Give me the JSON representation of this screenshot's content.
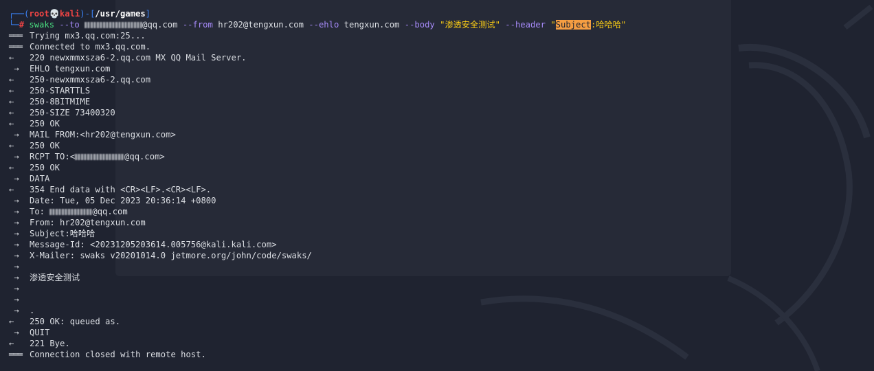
{
  "prompt": {
    "corner": "┌──",
    "open": "(",
    "user": "root",
    "skull_icon": "💀",
    "host": "kali",
    "close_mid": ")-[",
    "path": "/usr/games",
    "close": "]",
    "hash_prefix": "└─",
    "hash": "#"
  },
  "command": {
    "name": "swaks",
    "to_flag": "--to",
    "to_domain": "@qq.com",
    "from_flag": "--from",
    "from_value": "hr202@tengxun.com",
    "ehlo_flag": "--ehlo",
    "ehlo_value": "tengxun.com",
    "body_flag": "--body",
    "body_value": "\"渗透安全测试\"",
    "header_flag": "--header",
    "header_q": "\"",
    "header_key": "Subject",
    "header_rest": ":哈哈哈\""
  },
  "output": [
    {
      "arrow": "===",
      "text": "Trying mx3.qq.com:25..."
    },
    {
      "arrow": "===",
      "text": "Connected to mx3.qq.com."
    },
    {
      "arrow": "<-",
      "text": "220 newxmmxsza6-2.qq.com MX QQ Mail Server."
    },
    {
      "arrow": " ->",
      "text": "EHLO tengxun.com"
    },
    {
      "arrow": "<-",
      "text": "250-newxmmxsza6-2.qq.com"
    },
    {
      "arrow": "<-",
      "text": "250-STARTTLS"
    },
    {
      "arrow": "<-",
      "text": "250-8BITMIME"
    },
    {
      "arrow": "<-",
      "text": "250-SIZE 73400320"
    },
    {
      "arrow": "<-",
      "text": "250 OK"
    },
    {
      "arrow": " ->",
      "text": "MAIL FROM:<hr202@tengxun.com>"
    },
    {
      "arrow": "<-",
      "text": "250 OK"
    },
    {
      "arrow": " ->",
      "text": "RCPT TO:<",
      "blur": 72,
      "after": "@qq.com>"
    },
    {
      "arrow": "<-",
      "text": "250 OK"
    },
    {
      "arrow": " ->",
      "text": "DATA"
    },
    {
      "arrow": "<-",
      "text": "354 End data with <CR><LF>.<CR><LF>."
    },
    {
      "arrow": " ->",
      "text": "Date: Tue, 05 Dec 2023 20:36:14 +0800"
    },
    {
      "arrow": " ->",
      "text": "To: ",
      "blur": 62,
      "after": "@qq.com"
    },
    {
      "arrow": " ->",
      "text": "From: hr202@tengxun.com"
    },
    {
      "arrow": " ->",
      "text": "Subject:哈哈哈"
    },
    {
      "arrow": " ->",
      "text": "Message-Id: <20231205203614.005756@kali.kali.com>"
    },
    {
      "arrow": " ->",
      "text": "X-Mailer: swaks v20201014.0 jetmore.org/john/code/swaks/"
    },
    {
      "arrow": " ->",
      "text": ""
    },
    {
      "arrow": " ->",
      "text": "渗透安全测试"
    },
    {
      "arrow": " ->",
      "text": ""
    },
    {
      "arrow": " ->",
      "text": ""
    },
    {
      "arrow": " ->",
      "text": "."
    },
    {
      "arrow": "<-",
      "text": "250 OK: queued as."
    },
    {
      "arrow": " ->",
      "text": "QUIT"
    },
    {
      "arrow": "<-",
      "text": "221 Bye."
    },
    {
      "arrow": "===",
      "text": "Connection closed with remote host."
    }
  ],
  "colors": {
    "background": "#1f2330",
    "prompt_blue": "#3b82f6",
    "prompt_red": "#ef4444",
    "command_green": "#4ade80",
    "option_purple": "#a78bfa",
    "string_yellow": "#facc15",
    "highlight_orange": "#f59e42"
  }
}
